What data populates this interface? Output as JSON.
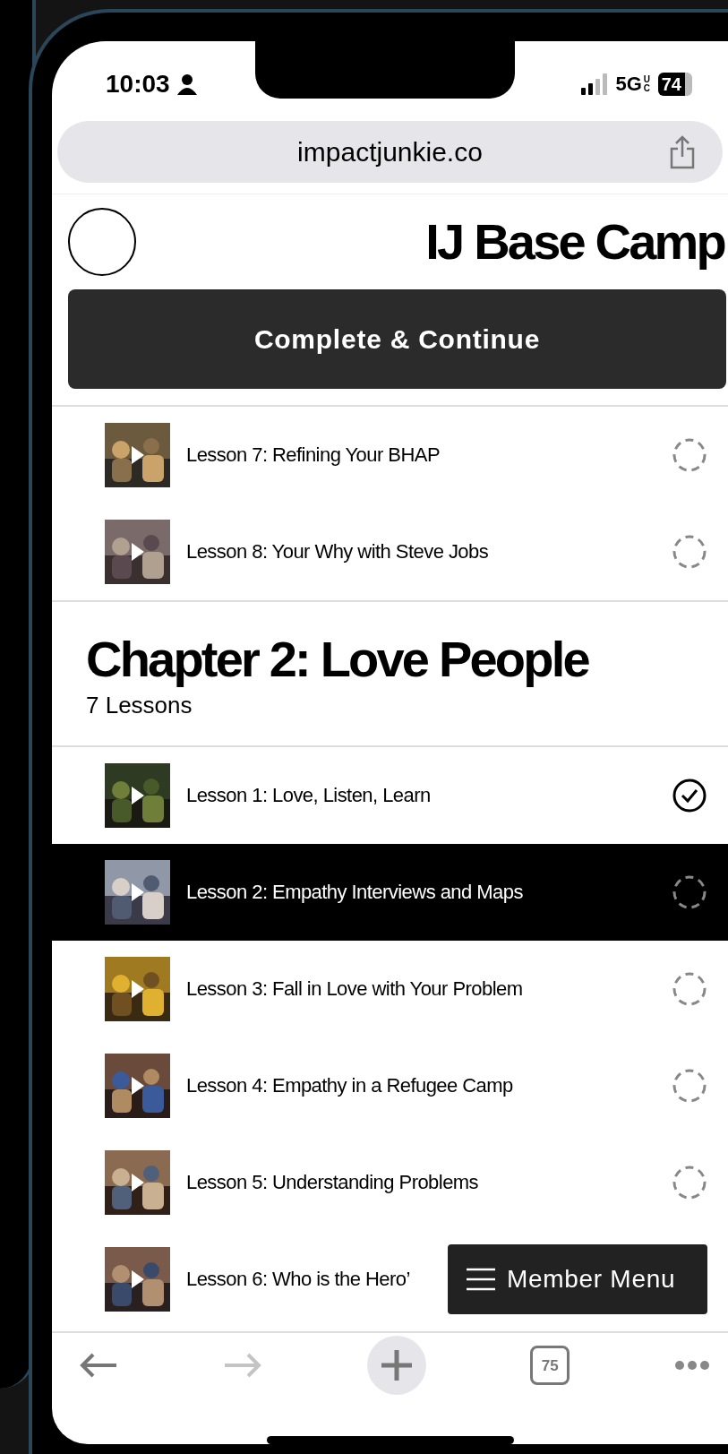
{
  "status_bar": {
    "time": "10:03",
    "network": "5G",
    "network_sub": "UC",
    "battery": "74"
  },
  "browser": {
    "url": "impactjunkie.co",
    "tab_count": "75",
    "back": {
      "disabled": false
    },
    "forward": {
      "disabled": true
    }
  },
  "header": {
    "title": "IJ Base Camp"
  },
  "complete_button": "Complete & Continue",
  "lessons": [
    {
      "title": "Lesson 7: Refining Your BHAP",
      "completed": false,
      "selected": false
    },
    {
      "title": "Lesson 8: Your Why with Steve Jobs",
      "completed": false,
      "selected": false
    }
  ],
  "chapters": [
    {
      "title": "Chapter 2: Love People",
      "lesson_count": "7 Lessons",
      "lessons": [
        {
          "title": "Lesson 1: Love, Listen, Learn",
          "completed": true,
          "selected": false
        },
        {
          "title": "Lesson 2: Empathy Interviews and Maps",
          "completed": false,
          "selected": true
        },
        {
          "title": "Lesson 3: Fall in Love with Your Problem",
          "completed": false,
          "selected": false
        },
        {
          "title": "Lesson 4: Empathy in a Refugee Camp",
          "completed": false,
          "selected": false
        },
        {
          "title": "Lesson 5: Understanding Problems",
          "completed": false,
          "selected": false
        },
        {
          "title": "Lesson 6: Who is the Hero’",
          "selected": false
        }
      ]
    }
  ],
  "member_menu": "Member Menu"
}
